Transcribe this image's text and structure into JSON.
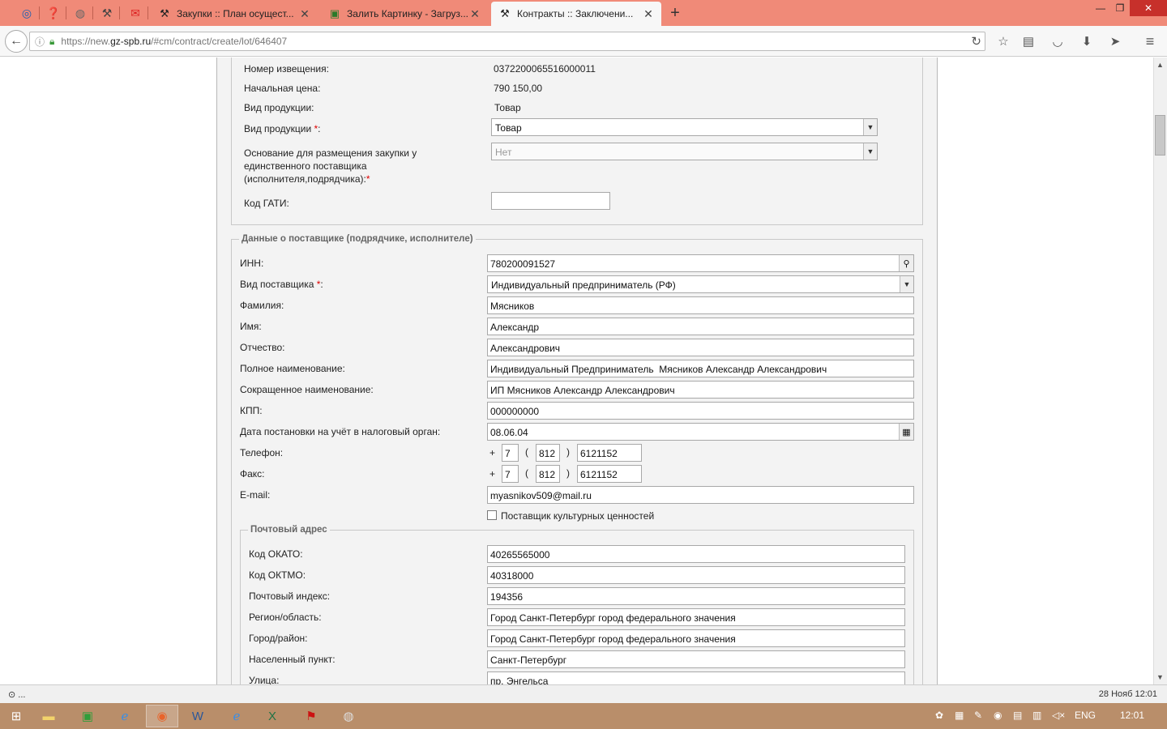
{
  "browser": {
    "tabs": [
      {
        "title": "Закупки :: План осущест...",
        "icon": "hammer-icon"
      },
      {
        "title": "Залить Картинку - Загруз...",
        "icon": "image-icon"
      },
      {
        "title": "Контракты :: Заключени...",
        "icon": "hammer-icon",
        "active": true
      }
    ],
    "new_tab": "+",
    "close_glyph": "✕",
    "url_prefix": "https://new.",
    "url_domain": "gz-spb.ru",
    "url_path": "/#cm/contract/create/lot/646407"
  },
  "lot": {
    "notice_label": "Номер извещения:",
    "notice_value": "0372200065516000011",
    "price_label": "Начальная цена:",
    "price_value": "790 150,00",
    "kind_label": "Вид продукции:",
    "kind_value": "Товар",
    "kind_select_label": "Вид продукции ",
    "kind_select_value": "Товар",
    "basis_label_1": "Основание для размещения закупки у",
    "basis_label_2": "единственного поставщика",
    "basis_label_3": "(исполнителя,подрядчика):",
    "basis_value": "Нет",
    "gati_label": "Код ГАТИ:",
    "gati_value": ""
  },
  "supplier": {
    "legend": "Данные о поставщике (подрядчике, исполнителе)",
    "inn_label": "ИНН:",
    "inn_value": "780200091527",
    "type_label": "Вид поставщика ",
    "type_value": "Индивидуальный предприниматель (РФ)",
    "last_label": "Фамилия:",
    "last_value": "Мясников",
    "first_label": "Имя:",
    "first_value": "Александр",
    "middle_label": "Отчество:",
    "middle_value": "Александрович",
    "full_label": "Полное наименование:",
    "full_value": "Индивидуальный Предприниматель  Мясников Александр Александрович",
    "short_label": "Сокращенное наименование:",
    "short_value": "ИП Мясников Александр Александрович",
    "kpp_label": "КПП:",
    "kpp_value": "000000000",
    "date_label": "Дата постановки на учёт в налоговый орган:",
    "date_value": "08.06.04",
    "phone_label": "Телефон:",
    "fax_label": "Факс:",
    "plus": "+",
    "lparen": "(",
    "rparen": ")",
    "phone_country": "7",
    "phone_code": "812",
    "phone_number": "6121152",
    "fax_country": "7",
    "fax_code": "812",
    "fax_number": "6121152",
    "email_label": "E-mail:",
    "email_value": "myasnikov509@mail.ru",
    "cultural_label": "Поставщик культурных ценностей",
    "required_mark": "*",
    "colon": ":"
  },
  "postal": {
    "legend": "Почтовый адрес",
    "okato_label": "Код ОКАТО:",
    "okato_value": "40265565000",
    "oktmo_label": "Код ОКТМО:",
    "oktmo_value": "40318000",
    "index_label": "Почтовый индекс:",
    "index_value": "194356",
    "region_label": "Регион/область:",
    "region_value": "Город Санкт-Петербург город федерального значения",
    "city_label": "Город/район:",
    "city_value": "Город Санкт-Петербург город федерального значения",
    "locality_label": "Населенный пункт:",
    "locality_value": "Санкт-Петербург",
    "street_label": "Улица:",
    "street_value": "пр. Энгельса"
  },
  "status": {
    "left": "⊙ ...",
    "right": "28 Нояб 12:01"
  },
  "taskbar": {
    "lang": "ENG",
    "time": "12:01"
  }
}
